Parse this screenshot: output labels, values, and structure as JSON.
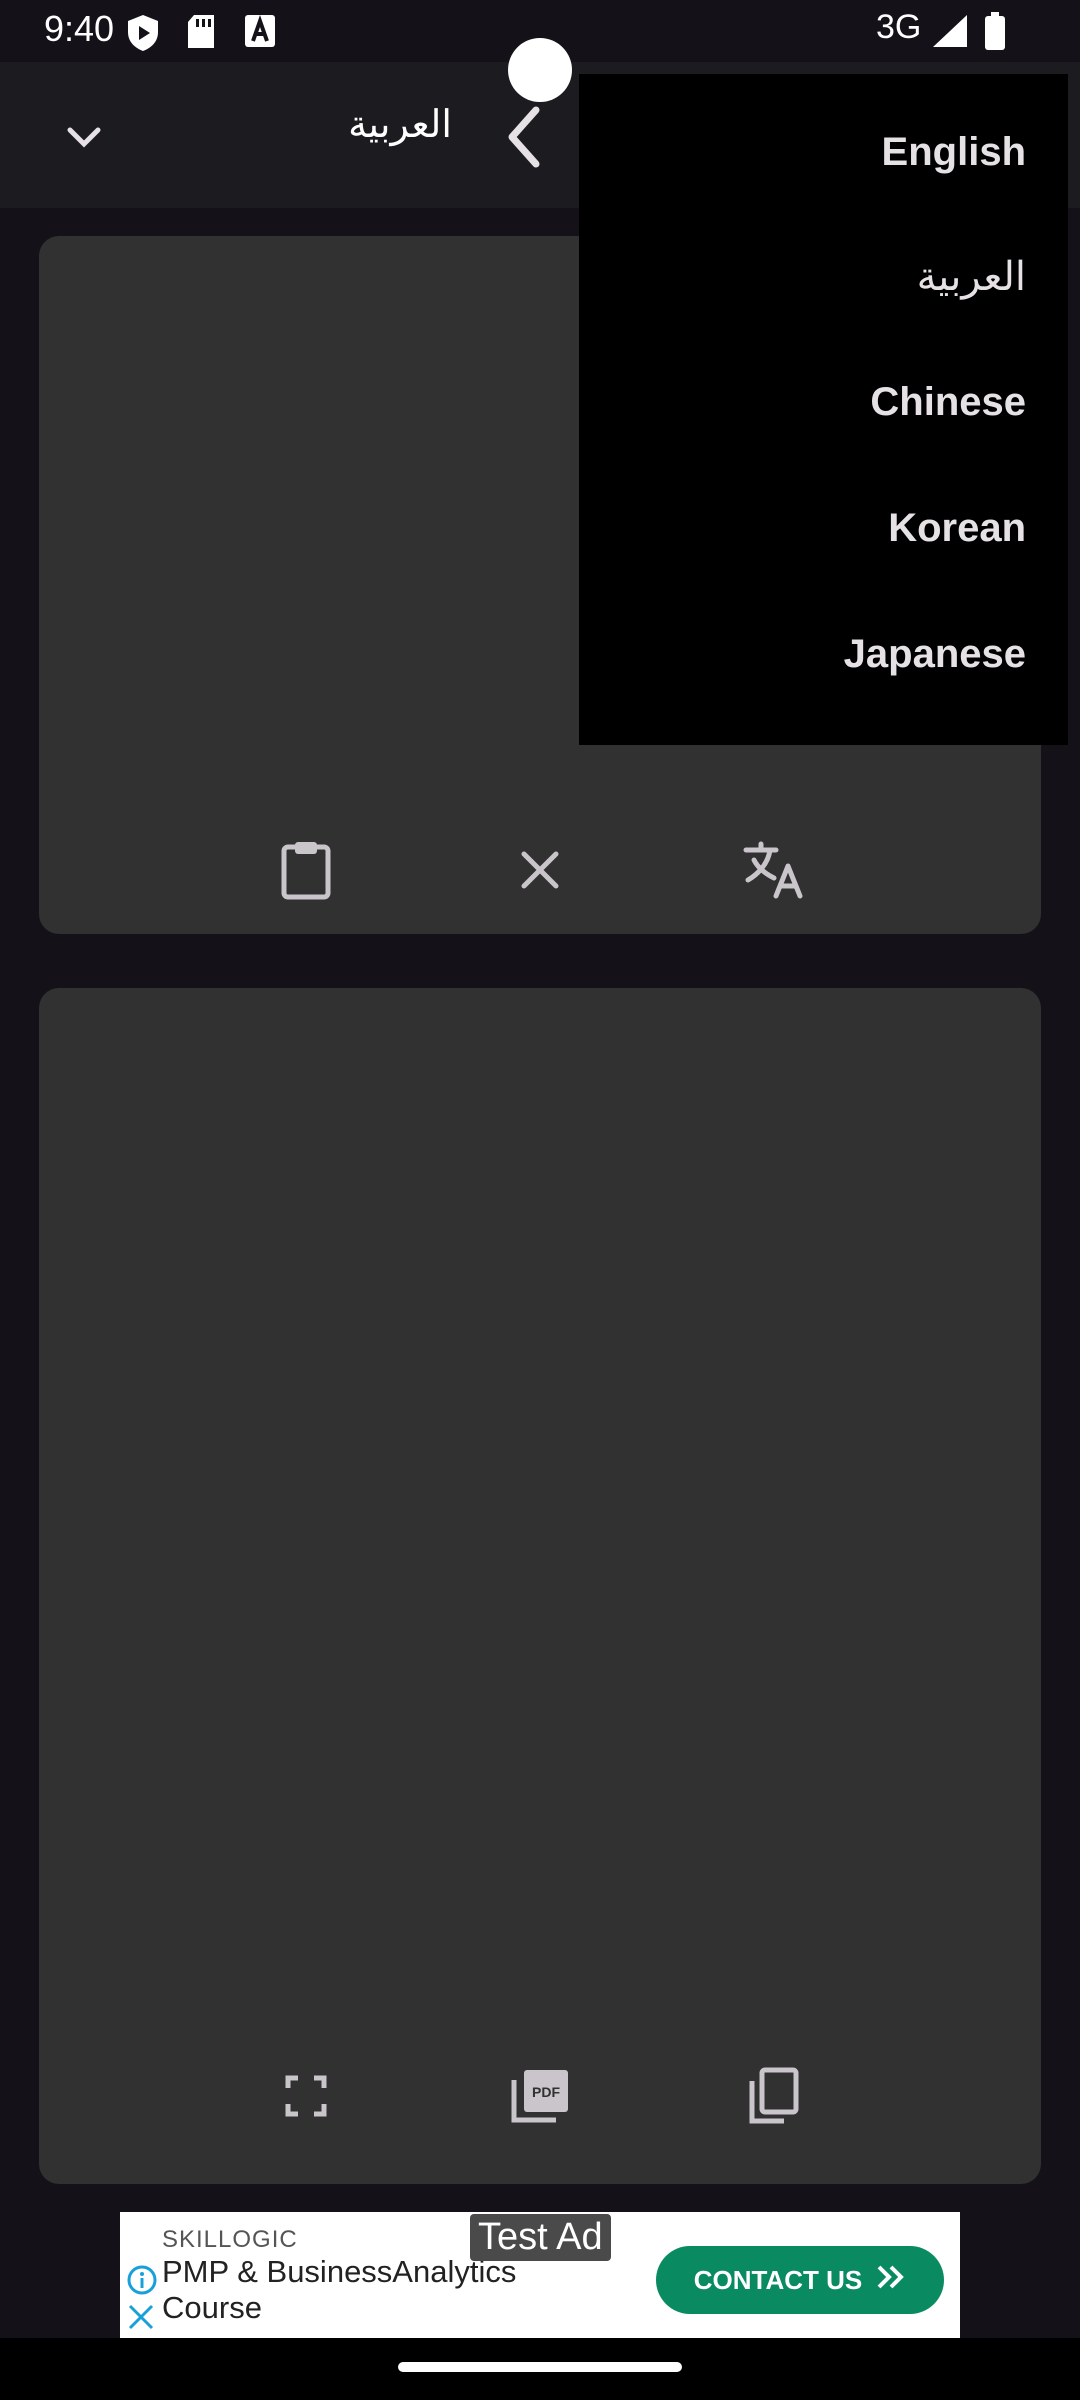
{
  "status_bar": {
    "time": "9:40",
    "network": "3G",
    "icons": [
      "shield-play-icon",
      "sd-card-icon",
      "font-a-icon",
      "signal-icon",
      "battery-icon"
    ]
  },
  "toolbar": {
    "source_language": "العربية",
    "icons": [
      "chevron-down-icon",
      "back-chevron-icon"
    ]
  },
  "language_menu": {
    "items": [
      "English",
      "العربية",
      "Chinese",
      "Korean",
      "Japanese"
    ]
  },
  "input_card": {
    "actions": [
      "paste-icon",
      "clear-icon",
      "translate-icon"
    ]
  },
  "output_card": {
    "actions": [
      "fullscreen-icon",
      "pdf-icon",
      "copy-icon"
    ]
  },
  "ad": {
    "badge": "Test Ad",
    "brand": "SKILLOGIC",
    "title": "PMP & BusinessAnalytics Course",
    "cta": "CONTACT US",
    "accent_color": "#0a8a61"
  },
  "colors": {
    "background": "#141218",
    "card": "#313131",
    "menu": "#000000"
  }
}
